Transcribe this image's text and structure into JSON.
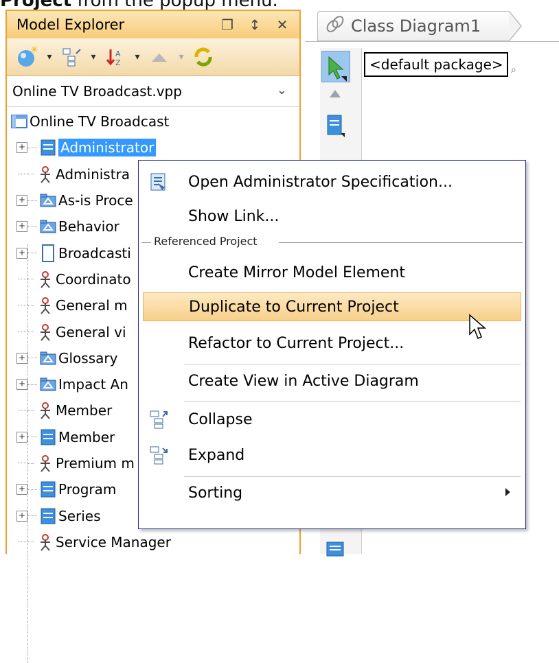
{
  "caption": {
    "bold": "Project",
    "rest": " from the popup menu."
  },
  "explorer": {
    "title": "Model Explorer",
    "title_buttons": [
      "restore-icon",
      "pin-icon",
      "close-icon"
    ],
    "project_select": "Online TV Broadcast.vpp",
    "tree": {
      "root": "Online TV Broadcast",
      "items": [
        {
          "label": "Administrator",
          "icon": "class-icon",
          "expandable": true,
          "selected": true
        },
        {
          "label": "Administra",
          "icon": "actor-icon",
          "expandable": false
        },
        {
          "label": "As-is Proce",
          "icon": "package-icon",
          "expandable": true
        },
        {
          "label": "Behavior",
          "icon": "package-icon",
          "expandable": true
        },
        {
          "label": "Broadcasti",
          "icon": "document-icon",
          "expandable": true
        },
        {
          "label": "Coordinato",
          "icon": "actor-icon",
          "expandable": false
        },
        {
          "label": "General m",
          "icon": "actor-icon",
          "expandable": false
        },
        {
          "label": "General vi",
          "icon": "actor-icon",
          "expandable": false
        },
        {
          "label": "Glossary",
          "icon": "package-icon",
          "expandable": true
        },
        {
          "label": "Impact An",
          "icon": "package-icon",
          "expandable": true
        },
        {
          "label": "Member",
          "icon": "actor-icon",
          "expandable": false
        },
        {
          "label": "Member",
          "icon": "class-icon",
          "expandable": true
        },
        {
          "label": "Premium m",
          "icon": "actor-icon",
          "expandable": false
        },
        {
          "label": "Program",
          "icon": "class-icon",
          "expandable": true
        },
        {
          "label": "Series",
          "icon": "class-icon",
          "expandable": true
        },
        {
          "label": "Service Manager",
          "icon": "actor-icon",
          "expandable": false
        }
      ]
    }
  },
  "diagram": {
    "tab_label": "Class Diagram1",
    "package_field": "<default package>"
  },
  "context_menu": {
    "items": [
      {
        "label": "Open Administrator Specification...",
        "icon": "specification-icon"
      },
      {
        "label": "Show Link...",
        "icon": ""
      },
      {
        "label": "Create Mirror Model Element",
        "icon": ""
      },
      {
        "label": "Duplicate to Current Project",
        "icon": "",
        "highlighted": true
      },
      {
        "label": "Refactor to Current Project...",
        "icon": ""
      },
      {
        "label": "Create View in Active Diagram",
        "icon": ""
      },
      {
        "label": "Collapse",
        "icon": "collapse-icon"
      },
      {
        "label": "Expand",
        "icon": "expand-icon"
      },
      {
        "label": "Sorting",
        "icon": "",
        "submenu": true
      }
    ],
    "group_header": "Referenced Project"
  },
  "colors": {
    "selection": "#3399ff",
    "panel_border": "#f0a030",
    "menu_highlight": "#f7d08a",
    "menu_border": "#1f2d8a"
  }
}
